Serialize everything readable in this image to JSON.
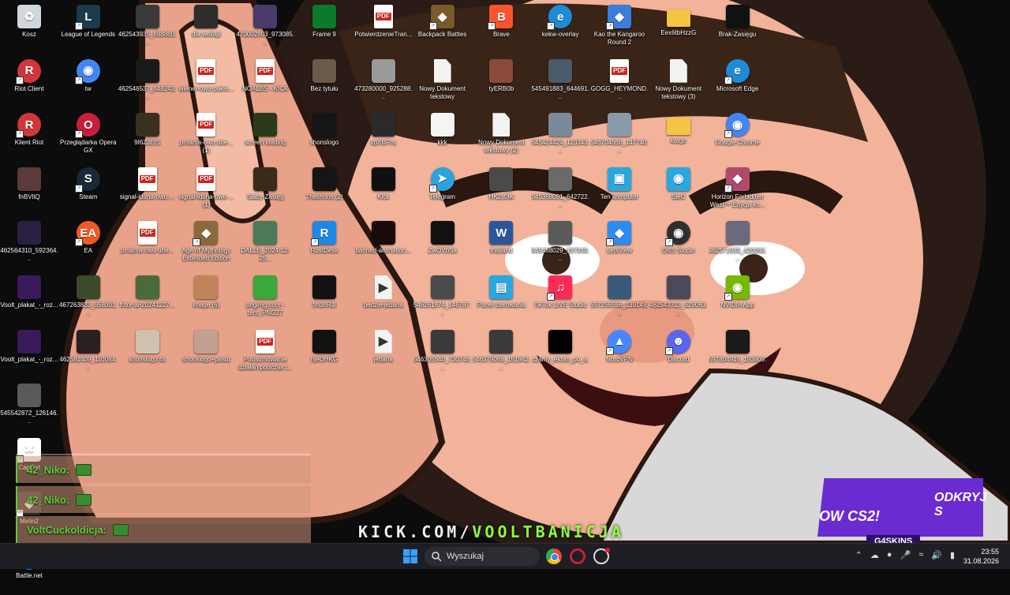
{
  "desktop_icons": [
    {
      "label": "Kosz",
      "icon": "recycle-bin-icon",
      "color": "#cfd8dc"
    },
    {
      "label": "League of Legends",
      "icon": "lol-icon",
      "color": "#1b3a4b"
    },
    {
      "label": "462543935_888860...",
      "icon": "image-icon",
      "color": "#3a3a3a"
    },
    {
      "label": "dla wellajji",
      "icon": "image-icon",
      "color": "#2d2d2d"
    },
    {
      "label": "470002803_973085...",
      "icon": "image-icon",
      "color": "#4a3a6a"
    },
    {
      "label": "Frame 9",
      "icon": "image-icon",
      "color": "#0c7a2a"
    },
    {
      "label": "PotwierdzenieTran...",
      "icon": "pdf-icon",
      "color": "#d9251c"
    },
    {
      "label": "Backpack Battles",
      "icon": "game-icon",
      "color": "#7a5a2a"
    },
    {
      "label": "Brave",
      "icon": "brave-icon",
      "color": "#fb542b"
    },
    {
      "label": "kekw-overlay",
      "icon": "edge-icon",
      "color": "#1f8ad6"
    },
    {
      "label": "Kao the Kangaroo Round 2",
      "icon": "game-icon",
      "color": "#3b7dd8"
    },
    {
      "label": "Eex6tbHzzG",
      "icon": "folder-icon",
      "color": "#f6c443"
    },
    {
      "label": "Brak-Zasięgu",
      "icon": "image-icon",
      "color": "#111111"
    },
    {
      "label": "Riot Client",
      "icon": "riot-icon",
      "color": "#d13639"
    },
    {
      "label": "tw",
      "icon": "chrome-icon",
      "color": "#4285f4"
    },
    {
      "label": "462546537_848243...",
      "icon": "image-icon",
      "color": "#1a1a1a"
    },
    {
      "label": "wiener-owu-pakie...",
      "icon": "pdf-icon",
      "color": "#d9251c"
    },
    {
      "label": "NOALBS - KICK",
      "icon": "pdf-icon",
      "color": "#d9251c"
    },
    {
      "label": "Bez tytułu",
      "icon": "image-icon",
      "color": "#6a5a4a"
    },
    {
      "label": "473280000_925288...",
      "icon": "image-icon",
      "color": "#9a9a9a"
    },
    {
      "label": "Nowy Dokument tekstowy",
      "icon": "text-doc-icon",
      "color": "#f3f3f3"
    },
    {
      "label": "tyERB0b",
      "icon": "image-icon",
      "color": "#8a4a3a"
    },
    {
      "label": "545491883_644691...",
      "icon": "image-icon",
      "color": "#4a5a6a"
    },
    {
      "label": "GOGG_HEYMOND...",
      "icon": "pdf-icon",
      "color": "#d9251c"
    },
    {
      "label": "Nowy Dokument tekstowy (3)",
      "icon": "text-doc-icon",
      "color": "#f3f3f3"
    },
    {
      "label": "Microsoft Edge",
      "icon": "edge-icon",
      "color": "#1f8ad6"
    },
    {
      "label": "Klient Riot",
      "icon": "riot-icon",
      "color": "#d13639"
    },
    {
      "label": "Przeglądarka Opera GX",
      "icon": "opera-icon",
      "color": "#c81e3a"
    },
    {
      "label": "9I6ZJEIS",
      "icon": "image-icon",
      "color": "#3a3020"
    },
    {
      "label": "proama-owu-ube... (1)",
      "icon": "pdf-icon",
      "color": "#d9251c"
    },
    {
      "label": "screen loading",
      "icon": "image-icon",
      "color": "#2a3a1a"
    },
    {
      "label": "shonslogo",
      "icon": "image-icon",
      "color": "#151515"
    },
    {
      "label": "vpXUFcs",
      "icon": "image-icon",
      "color": "#2a2a2a"
    },
    {
      "label": "kkk",
      "icon": "image-icon",
      "color": "#f5f5f5"
    },
    {
      "label": "Nowy Dokument tekstowy (2)",
      "icon": "text-doc-icon",
      "color": "#f3f3f3"
    },
    {
      "label": "545424424_123343...",
      "icon": "image-icon",
      "color": "#7a8a9a"
    },
    {
      "label": "546704668_147740...",
      "icon": "image-icon",
      "color": "#8a9aaa"
    },
    {
      "label": "kargo",
      "icon": "folder-icon",
      "color": "#f6c443"
    },
    {
      "label": "Google Chrome",
      "icon": "chrome-icon",
      "color": "#4285f4"
    },
    {
      "label": "fnBVltQ",
      "icon": "image-icon",
      "color": "#5a3a3a"
    },
    {
      "label": "Steam",
      "icon": "steam-icon",
      "color": "#1b2838"
    },
    {
      "label": "signal-iduna-owu-...",
      "icon": "pdf-icon",
      "color": "#d9251c"
    },
    {
      "label": "signal-iduna-owu-... (1)",
      "icon": "pdf-icon",
      "color": "#d9251c"
    },
    {
      "label": "Słaby-Zasięg",
      "icon": "image-icon",
      "color": "#3a2a1a"
    },
    {
      "label": "Theshons (2)",
      "icon": "image-icon",
      "color": "#151515"
    },
    {
      "label": "Kick",
      "icon": "image-icon",
      "color": "#101010"
    },
    {
      "label": "Telegram",
      "icon": "telegram-icon",
      "color": "#2aa3df"
    },
    {
      "label": "HK2v0lw",
      "icon": "image-icon",
      "color": "#4a4a4a"
    },
    {
      "label": "545368091_642722...",
      "icon": "image-icon",
      "color": "#6a6a6a"
    },
    {
      "label": "Ten komputer",
      "icon": "computer-icon",
      "color": "#29a8e0"
    },
    {
      "label": "SieĆ",
      "icon": "network-icon",
      "color": "#29a8e0"
    },
    {
      "label": "Horizon Forbidden West™ Edycja ko...",
      "icon": "game-icon",
      "color": "#b04a6a"
    },
    {
      "label": "462564310_592364...",
      "icon": "image-icon",
      "color": "#2a2040"
    },
    {
      "label": "EA",
      "icon": "ea-icon",
      "color": "#f25a24"
    },
    {
      "label": "proama-owu-ube...",
      "icon": "pdf-icon",
      "color": "#d9251c"
    },
    {
      "label": "Age of Mythology Extended Edition",
      "icon": "game-icon",
      "color": "#8a6a3a"
    },
    {
      "label": "DALLE_2024-12-25...",
      "icon": "image-icon",
      "color": "#4a7a5a"
    },
    {
      "label": "RustDesk",
      "icon": "rustdesk-icon",
      "color": "#1e88e5"
    },
    {
      "label": "banned-animation...",
      "icon": "image-icon",
      "color": "#1a0a0a"
    },
    {
      "label": "ZwOVbSa",
      "icon": "image-icon",
      "color": "#111111"
    },
    {
      "label": "thailand",
      "icon": "word-icon",
      "color": "#2b579a"
    },
    {
      "label": "545468029_197340...",
      "icon": "image-icon",
      "color": "#5a5a5a"
    },
    {
      "label": "LetsView",
      "icon": "letsview-icon",
      "color": "#2d8cf0"
    },
    {
      "label": "OBS Studio",
      "icon": "obs-icon",
      "color": "#302e31"
    },
    {
      "label": "462571933_420263...",
      "icon": "image-icon",
      "color": "#6a6a7a"
    },
    {
      "label": "Voolt_plakat_-_roz...",
      "icon": "image-icon",
      "color": "#3a1a5a"
    },
    {
      "label": "467263823_958001...",
      "icon": "image-icon",
      "color": "#3a4a2a"
    },
    {
      "label": "fotor-ai-20241227...",
      "icon": "image-icon",
      "color": "#4a6a3a"
    },
    {
      "label": "image (6)",
      "icon": "image-icon",
      "color": "#c0845a"
    },
    {
      "label": "pngimg.com - tent_PNG27",
      "icon": "image-icon",
      "color": "#3aa83a"
    },
    {
      "label": "fm3nRJI",
      "icon": "image-icon",
      "color": "#111111"
    },
    {
      "label": "bedzie-jebana",
      "icon": "video-icon",
      "color": "#f3f3f3"
    },
    {
      "label": "546261874_146787...",
      "icon": "image-icon",
      "color": "#4a4a4a"
    },
    {
      "label": "Panel sterowania",
      "icon": "control-panel-icon",
      "color": "#29a8e0"
    },
    {
      "label": "TikTok LIVE Studio",
      "icon": "tiktok-icon",
      "color": "#fe2c55"
    },
    {
      "label": "597256556_139149...",
      "icon": "image-icon",
      "color": "#3a5a7a"
    },
    {
      "label": "462543723_529063...",
      "icon": "image-icon",
      "color": "#4a4a5a"
    },
    {
      "label": "NVIDIA App",
      "icon": "nvidia-icon",
      "color": "#76b900"
    },
    {
      "label": "Voolt_plakat_-_roz...",
      "icon": "image-icon",
      "color": "#3a1a5a"
    },
    {
      "label": "462581409_110084...",
      "icon": "image-icon",
      "color": "#2a2020"
    },
    {
      "label": "shonslogo.fix",
      "icon": "image-icon",
      "color": "#d0c0b0"
    },
    {
      "label": "shonslogo+pasut",
      "icon": "image-icon",
      "color": "#c0a090"
    },
    {
      "label": "Podsumowanie działań podczas t...",
      "icon": "pdf-icon",
      "color": "#d9251c"
    },
    {
      "label": "hjeOHKG",
      "icon": "image-icon",
      "color": "#111111"
    },
    {
      "label": "jebana",
      "icon": "video-icon",
      "color": "#f3f3f3"
    },
    {
      "label": "546305540_730746...",
      "icon": "image-icon",
      "color": "#3a3a3a"
    },
    {
      "label": "546379068_151942...",
      "icon": "image-icon",
      "color": "#3a3a3a"
    },
    {
      "label": "czarny_ekran_po_a...",
      "icon": "image-icon",
      "color": "#000000"
    },
    {
      "label": "NordVPN",
      "icon": "nordvpn-icon",
      "color": "#4687ff"
    },
    {
      "label": "Discord",
      "icon": "discord-icon",
      "color": "#5865f2"
    },
    {
      "label": "597804918_193809...",
      "icon": "image-icon",
      "color": "#1a1a1a"
    },
    {
      "label": "545542872_126146...",
      "icon": "image-icon",
      "color": "#5a5a5a"
    },
    {
      "label": "CapCut",
      "icon": "capcut-icon",
      "color": "#ffffff"
    },
    {
      "label": "Metin2",
      "icon": "game-icon",
      "color": "#2a2a2a"
    },
    {
      "label": "Battle.net",
      "icon": "battlenet-icon",
      "color": "#148eff"
    }
  ],
  "chat": {
    "messages": [
      {
        "name": "42_Niko:"
      },
      {
        "name": "42_Niko:"
      },
      {
        "name": "VoltCuckoldicja:"
      }
    ]
  },
  "overlay": {
    "kick_prefix": "KICK.COM/",
    "kick_channel": "VOOLTBANICJA",
    "promo_line1": "ODKRYJ S",
    "promo_line2": "OW CS2!",
    "promo_brand": "G4SKINS"
  },
  "taskbar": {
    "search_placeholder": "Wyszukaj",
    "time": "23:55",
    "date": "31.08.2026"
  },
  "colors": {
    "taskbar": "#1d1f24",
    "chat_name": "#5ccd3a",
    "kick_accent": "#8fff3a",
    "promo": "#6a2bd1"
  }
}
